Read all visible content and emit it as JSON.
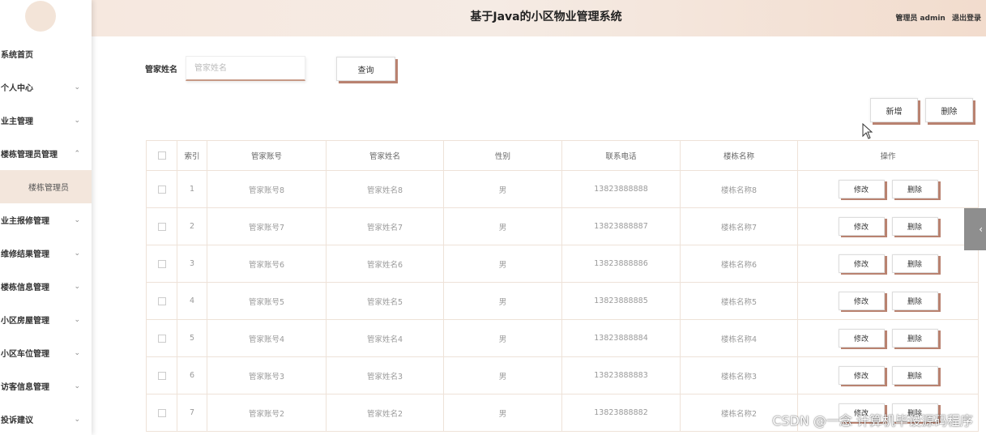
{
  "header": {
    "title": "基于Java的小区物业管理系统",
    "user_label": "管理员 admin",
    "logout_label": "退出登录"
  },
  "sidebar": {
    "items": [
      {
        "label": "系统首页",
        "chevron": ""
      },
      {
        "label": "个人中心",
        "chevron": "⌄"
      },
      {
        "label": "业主管理",
        "chevron": "⌄"
      },
      {
        "label": "楼栋管理员管理",
        "chevron": "⌃"
      },
      {
        "label": "楼栋管理员",
        "chevron": ""
      },
      {
        "label": "业主报修管理",
        "chevron": "⌄"
      },
      {
        "label": "维修结果管理",
        "chevron": "⌄"
      },
      {
        "label": "楼栋信息管理",
        "chevron": "⌄"
      },
      {
        "label": "小区房屋管理",
        "chevron": "⌄"
      },
      {
        "label": "小区车位管理",
        "chevron": "⌄"
      },
      {
        "label": "访客信息管理",
        "chevron": "⌄"
      },
      {
        "label": "投诉建议",
        "chevron": "⌄"
      }
    ]
  },
  "search": {
    "label": "管家姓名",
    "placeholder": "管家姓名",
    "value": "",
    "query_label": "查询"
  },
  "actions": {
    "add_label": "新增",
    "delete_label": "删除"
  },
  "table": {
    "headers": [
      "索引",
      "管家账号",
      "管家姓名",
      "性别",
      "联系电话",
      "楼栋名称",
      "操作"
    ],
    "rows": [
      {
        "index": "1",
        "account": "管家账号8",
        "name": "管家姓名8",
        "gender": "男",
        "phone": "13823888888",
        "building": "楼栋名称8"
      },
      {
        "index": "2",
        "account": "管家账号7",
        "name": "管家姓名7",
        "gender": "男",
        "phone": "13823888887",
        "building": "楼栋名称7"
      },
      {
        "index": "3",
        "account": "管家账号6",
        "name": "管家姓名6",
        "gender": "男",
        "phone": "13823888886",
        "building": "楼栋名称6"
      },
      {
        "index": "4",
        "account": "管家账号5",
        "name": "管家姓名5",
        "gender": "男",
        "phone": "13823888885",
        "building": "楼栋名称5"
      },
      {
        "index": "5",
        "account": "管家账号4",
        "name": "管家姓名4",
        "gender": "男",
        "phone": "13823888884",
        "building": "楼栋名称4"
      },
      {
        "index": "6",
        "account": "管家账号3",
        "name": "管家姓名3",
        "gender": "男",
        "phone": "13823888883",
        "building": "楼栋名称3"
      },
      {
        "index": "7",
        "account": "管家账号2",
        "name": "管家姓名2",
        "gender": "男",
        "phone": "13823888882",
        "building": "楼栋名称2"
      }
    ],
    "edit_label": "修改",
    "row_delete_label": "删除"
  },
  "side_tab_icon": "chevron-left-icon",
  "watermark": "CSDN @一念 计算机毕设源码程序",
  "colors": {
    "accent_shadow": "#b98270",
    "header_gradient_start": "#f6e8df",
    "header_gradient_end": "#f2dccd",
    "submenu_bg": "#f3e6dc"
  }
}
